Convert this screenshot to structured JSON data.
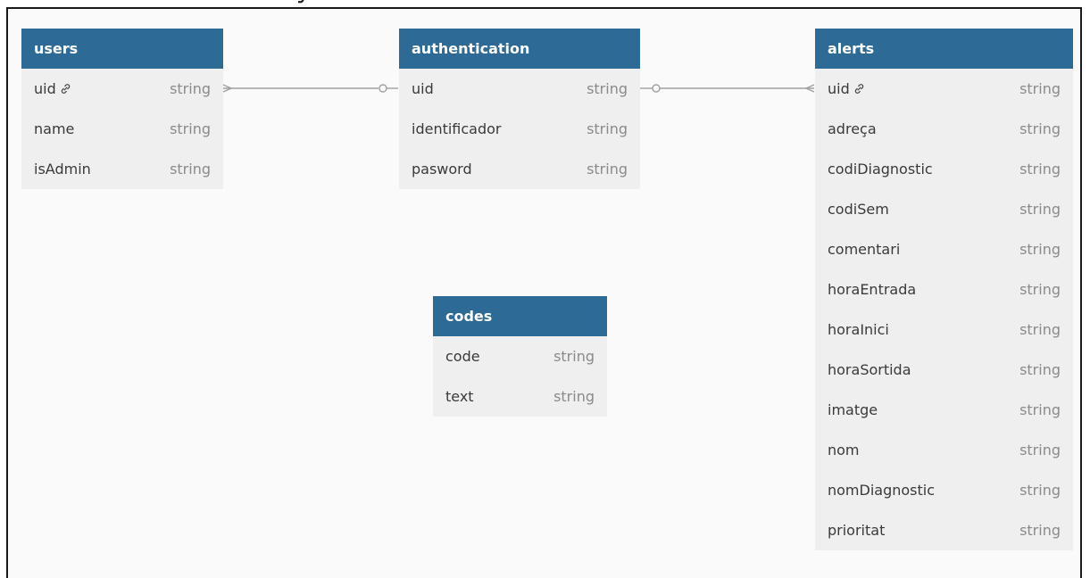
{
  "entities": {
    "users": {
      "name": "users",
      "fields": [
        {
          "name": "uid",
          "type": "string",
          "key": true
        },
        {
          "name": "name",
          "type": "string",
          "key": false
        },
        {
          "name": "isAdmin",
          "type": "string",
          "key": false
        }
      ]
    },
    "authentication": {
      "name": "authentication",
      "fields": [
        {
          "name": "uid",
          "type": "string",
          "key": false
        },
        {
          "name": "identificador",
          "type": "string",
          "key": false
        },
        {
          "name": "pasword",
          "type": "string",
          "key": false
        }
      ]
    },
    "alerts": {
      "name": "alerts",
      "fields": [
        {
          "name": "uid",
          "type": "string",
          "key": true
        },
        {
          "name": "adreça",
          "type": "string",
          "key": false
        },
        {
          "name": "codiDiagnostic",
          "type": "string",
          "key": false
        },
        {
          "name": "codiSem",
          "type": "string",
          "key": false
        },
        {
          "name": "comentari",
          "type": "string",
          "key": false
        },
        {
          "name": "horaEntrada",
          "type": "string",
          "key": false
        },
        {
          "name": "horaInici",
          "type": "string",
          "key": false
        },
        {
          "name": "horaSortida",
          "type": "string",
          "key": false
        },
        {
          "name": "imatge",
          "type": "string",
          "key": false
        },
        {
          "name": "nom",
          "type": "string",
          "key": false
        },
        {
          "name": "nomDiagnostic",
          "type": "string",
          "key": false
        },
        {
          "name": "prioritat",
          "type": "string",
          "key": false
        }
      ]
    },
    "codes": {
      "name": "codes",
      "fields": [
        {
          "name": "code",
          "type": "string",
          "key": false
        },
        {
          "name": "text",
          "type": "string",
          "key": false
        }
      ]
    }
  },
  "relationships": [
    {
      "from": "users.uid",
      "from_end": "many",
      "to": "authentication.uid",
      "to_end": "zero-or-one"
    },
    {
      "from": "authentication.uid",
      "from_end": "zero-or-one",
      "to": "alerts.uid",
      "to_end": "many"
    }
  ],
  "colors": {
    "header": "#2e6a96",
    "body": "#efefef",
    "canvas": "#fafafa",
    "line": "#9e9e9e"
  }
}
